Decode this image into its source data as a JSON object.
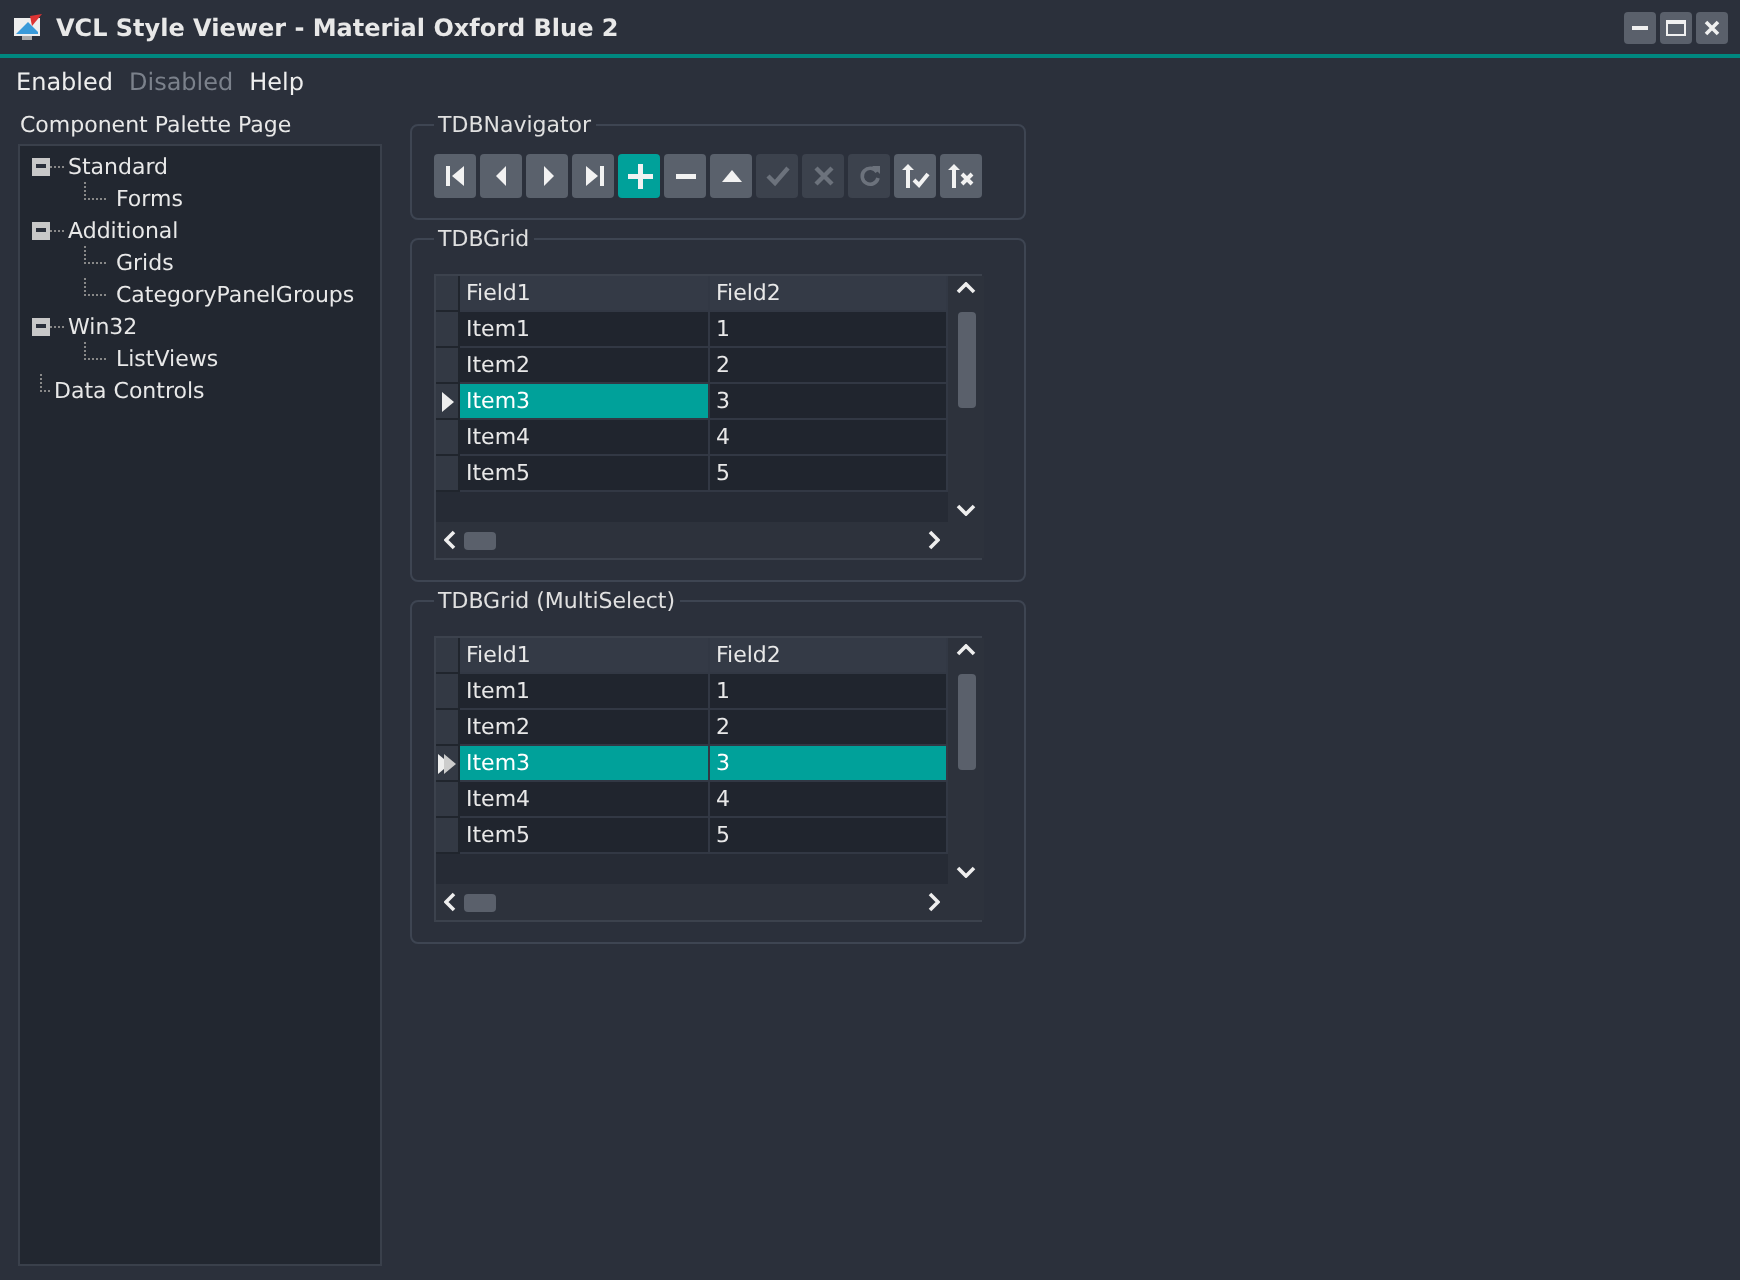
{
  "window": {
    "title": "VCL Style Viewer - Material Oxford Blue 2"
  },
  "menu": [
    {
      "label": "Enabled",
      "disabled": false
    },
    {
      "label": "Disabled",
      "disabled": true
    },
    {
      "label": "Help",
      "disabled": false
    }
  ],
  "sidebar": {
    "title": "Component Palette Page",
    "tree": [
      {
        "label": "Standard",
        "expanded": true,
        "children": [
          {
            "label": "Forms"
          }
        ]
      },
      {
        "label": "Additional",
        "expanded": true,
        "children": [
          {
            "label": "Grids"
          },
          {
            "label": "CategoryPanelGroups"
          }
        ]
      },
      {
        "label": "Win32",
        "expanded": true,
        "children": [
          {
            "label": "ListViews"
          }
        ]
      },
      {
        "label": "Data Controls"
      }
    ]
  },
  "navigator": {
    "title": "TDBNavigator",
    "buttons": [
      {
        "kind": "first",
        "disabled": false,
        "focused": false
      },
      {
        "kind": "prior",
        "disabled": false,
        "focused": false
      },
      {
        "kind": "next",
        "disabled": false,
        "focused": false
      },
      {
        "kind": "last",
        "disabled": false,
        "focused": false
      },
      {
        "kind": "insert",
        "disabled": false,
        "focused": true
      },
      {
        "kind": "delete",
        "disabled": false,
        "focused": false
      },
      {
        "kind": "edit",
        "disabled": false,
        "focused": false
      },
      {
        "kind": "post",
        "disabled": true,
        "focused": false
      },
      {
        "kind": "cancel",
        "disabled": true,
        "focused": false
      },
      {
        "kind": "refresh",
        "disabled": true,
        "focused": false
      },
      {
        "kind": "apply",
        "disabled": false,
        "focused": false
      },
      {
        "kind": "discard",
        "disabled": false,
        "focused": false
      }
    ]
  },
  "grids": [
    {
      "title": "TDBGrid",
      "multiselect": false,
      "columns": [
        "Field1",
        "Field2"
      ],
      "rows": [
        {
          "cells": [
            "Item1",
            "1"
          ],
          "selected": false
        },
        {
          "cells": [
            "Item2",
            "2"
          ],
          "selected": false
        },
        {
          "cells": [
            "Item3",
            "3"
          ],
          "selected": true
        },
        {
          "cells": [
            "Item4",
            "4"
          ],
          "selected": false
        },
        {
          "cells": [
            "Item5",
            "5"
          ],
          "selected": false
        }
      ]
    },
    {
      "title": "TDBGrid (MultiSelect)",
      "multiselect": true,
      "columns": [
        "Field1",
        "Field2"
      ],
      "rows": [
        {
          "cells": [
            "Item1",
            "1"
          ],
          "selected": false
        },
        {
          "cells": [
            "Item2",
            "2"
          ],
          "selected": false
        },
        {
          "cells": [
            "Item3",
            "3"
          ],
          "selected": true
        },
        {
          "cells": [
            "Item4",
            "4"
          ],
          "selected": false
        },
        {
          "cells": [
            "Item5",
            "5"
          ],
          "selected": false
        }
      ]
    }
  ]
}
